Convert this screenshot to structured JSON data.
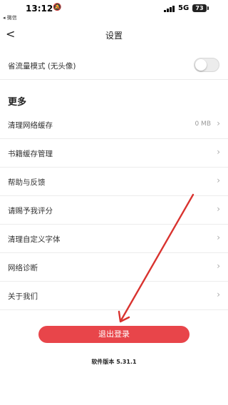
{
  "status_bar": {
    "time": "13:12",
    "back_app": "◂ 微信",
    "network": "5G",
    "battery": "73"
  },
  "nav": {
    "back_glyph": "<",
    "title": "设置"
  },
  "data_saver": {
    "label": "省流量模式 (无头像)",
    "enabled": false
  },
  "more_section": {
    "title": "更多",
    "items": [
      {
        "label": "清理网络缓存",
        "value": "0 MB"
      },
      {
        "label": "书籍缓存管理",
        "value": ""
      },
      {
        "label": "帮助与反馈",
        "value": ""
      },
      {
        "label": "请赐予我评分",
        "value": ""
      },
      {
        "label": "清理自定义字体",
        "value": ""
      },
      {
        "label": "网络诊断",
        "value": ""
      },
      {
        "label": "关于我们",
        "value": ""
      }
    ]
  },
  "logout_label": "退出登录",
  "version": "软件版本 5.31.1",
  "colors": {
    "accent": "#e8454a",
    "annotation_arrow": "#d9332f"
  }
}
